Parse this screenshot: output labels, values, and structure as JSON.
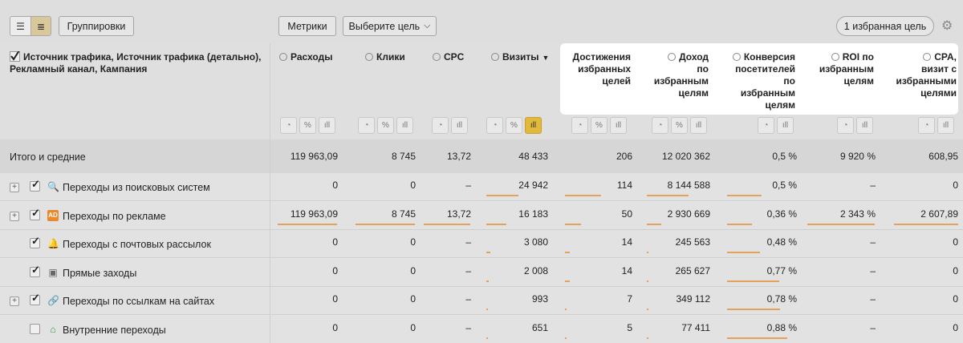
{
  "toolbar": {
    "groupings_label": "Группировки",
    "metrics_label": "Метрики",
    "goal_label": "Выберите цель",
    "favorite_goal_label": "1 избранная цель"
  },
  "header": {
    "first_column": "Источник трафика, Источник трафика (детально), Рекламный канал, Кампания",
    "columns": [
      {
        "label": "Расходы"
      },
      {
        "label": "Клики"
      },
      {
        "label": "CPC"
      },
      {
        "label": "Визиты",
        "sort": "▼"
      },
      {
        "label": "Достижения избранных целей"
      },
      {
        "label": "Доход по избранным целям"
      },
      {
        "label": "Конверсия посетителей по избранным целям"
      },
      {
        "label": "ROI по избранным целям"
      },
      {
        "label": "CPA, визит с избранными целями"
      }
    ]
  },
  "totals": {
    "label": "Итого и средние",
    "values": [
      "119 963,09",
      "8 745",
      "13,72",
      "48 433",
      "206",
      "12 020 362",
      "0,5 %",
      "9 920 %",
      "608,95"
    ]
  },
  "rows": [
    {
      "label": "Переходы из поисковых систем",
      "icon": "search-icon",
      "expandable": true,
      "checked": true,
      "values": [
        "0",
        "0",
        "–",
        "24 942",
        "114",
        "8 144 588",
        "0,5 %",
        "–",
        "0"
      ],
      "bars": [
        0,
        0,
        0,
        0.52,
        0.55,
        0.68,
        0.5,
        0,
        0
      ]
    },
    {
      "label": "Переходы по рекламе",
      "icon": "ad-icon",
      "expandable": true,
      "checked": true,
      "values": [
        "119 963,09",
        "8 745",
        "13,72",
        "16 183",
        "50",
        "2 930 669",
        "0,36 %",
        "2 343 %",
        "2 607,89"
      ],
      "bars": [
        1,
        1,
        1,
        0.33,
        0.24,
        0.24,
        0.36,
        1,
        1
      ]
    },
    {
      "label": "Переходы с почтовых рассылок",
      "icon": "mail-icon",
      "expandable": false,
      "checked": true,
      "values": [
        "0",
        "0",
        "–",
        "3 080",
        "14",
        "245 563",
        "0,48 %",
        "–",
        "0"
      ],
      "bars": [
        0,
        0,
        0,
        0.06,
        0.07,
        0.02,
        0.48,
        0,
        0
      ]
    },
    {
      "label": "Прямые заходы",
      "icon": "direct-icon",
      "expandable": false,
      "checked": true,
      "values": [
        "0",
        "0",
        "–",
        "2 008",
        "14",
        "265 627",
        "0,77 %",
        "–",
        "0"
      ],
      "bars": [
        0,
        0,
        0,
        0.04,
        0.07,
        0.02,
        0.77,
        0,
        0
      ]
    },
    {
      "label": "Переходы по ссылкам на сайтах",
      "icon": "link-icon",
      "expandable": true,
      "checked": true,
      "values": [
        "0",
        "0",
        "–",
        "993",
        "7",
        "349 112",
        "0,78 %",
        "–",
        "0"
      ],
      "bars": [
        0,
        0,
        0,
        0.02,
        0.03,
        0.03,
        0.78,
        0,
        0
      ]
    },
    {
      "label": "Внутренние переходы",
      "icon": "home-icon",
      "expandable": false,
      "checked": false,
      "values": [
        "0",
        "0",
        "–",
        "651",
        "5",
        "77 411",
        "0,88 %",
        "–",
        "0"
      ],
      "bars": [
        0,
        0,
        0,
        0.01,
        0.02,
        0.01,
        0.88,
        0,
        0
      ]
    }
  ],
  "colors": {
    "bar": "#e3a25b",
    "active_chart_toggle": "#e3b93c",
    "highlight": "#ffffff"
  }
}
